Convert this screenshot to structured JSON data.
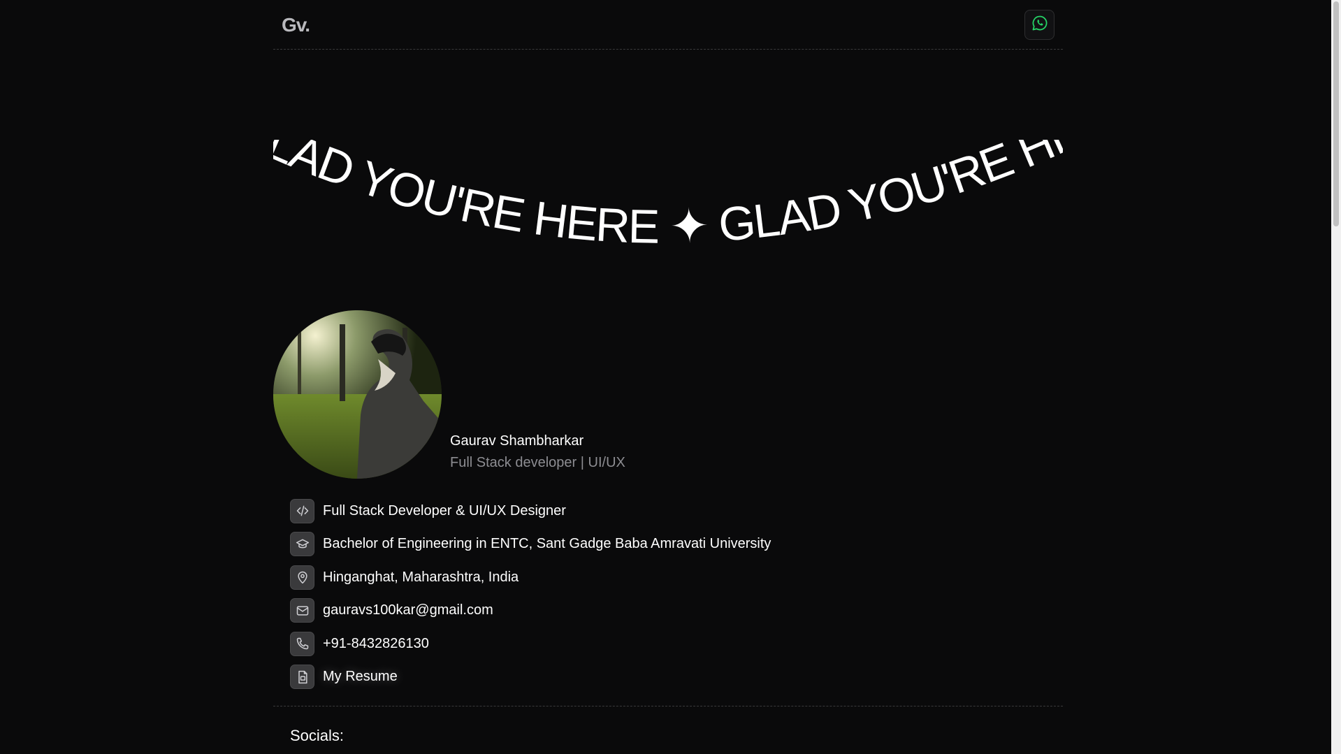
{
  "header": {
    "logo": "Gv.",
    "whatsapp_icon": "whatsapp-icon"
  },
  "hero": {
    "curved_text": "GLAD YOU'RE HERE ✦ GLAD YOU'RE HERE ✦ GLAD YOU'RE HERE ✦"
  },
  "profile": {
    "name": "Gaurav Shambharkar",
    "role": "Full Stack developer | UI/UX"
  },
  "info": [
    {
      "icon": "code-icon",
      "text": "Full Stack Developer & UI/UX Designer"
    },
    {
      "icon": "graduation-cap-icon",
      "text": "Bachelor of Engineering in ENTC, Sant Gadge Baba Amravati University"
    },
    {
      "icon": "location-pin-icon",
      "text": "Hinganghat, Maharashtra, India"
    },
    {
      "icon": "mail-icon",
      "text": "gauravs100kar@gmail.com"
    },
    {
      "icon": "phone-icon",
      "text": "+91-8432826130"
    },
    {
      "icon": "resume-file-icon",
      "text": "My Resume"
    }
  ],
  "socials": {
    "heading": "Socials:"
  },
  "colors": {
    "background": "#0a0a0b",
    "text": "#ffffff",
    "muted": "#8d8d92",
    "whatsapp": "#25d366",
    "icon_bg": "#3a3a3c"
  }
}
